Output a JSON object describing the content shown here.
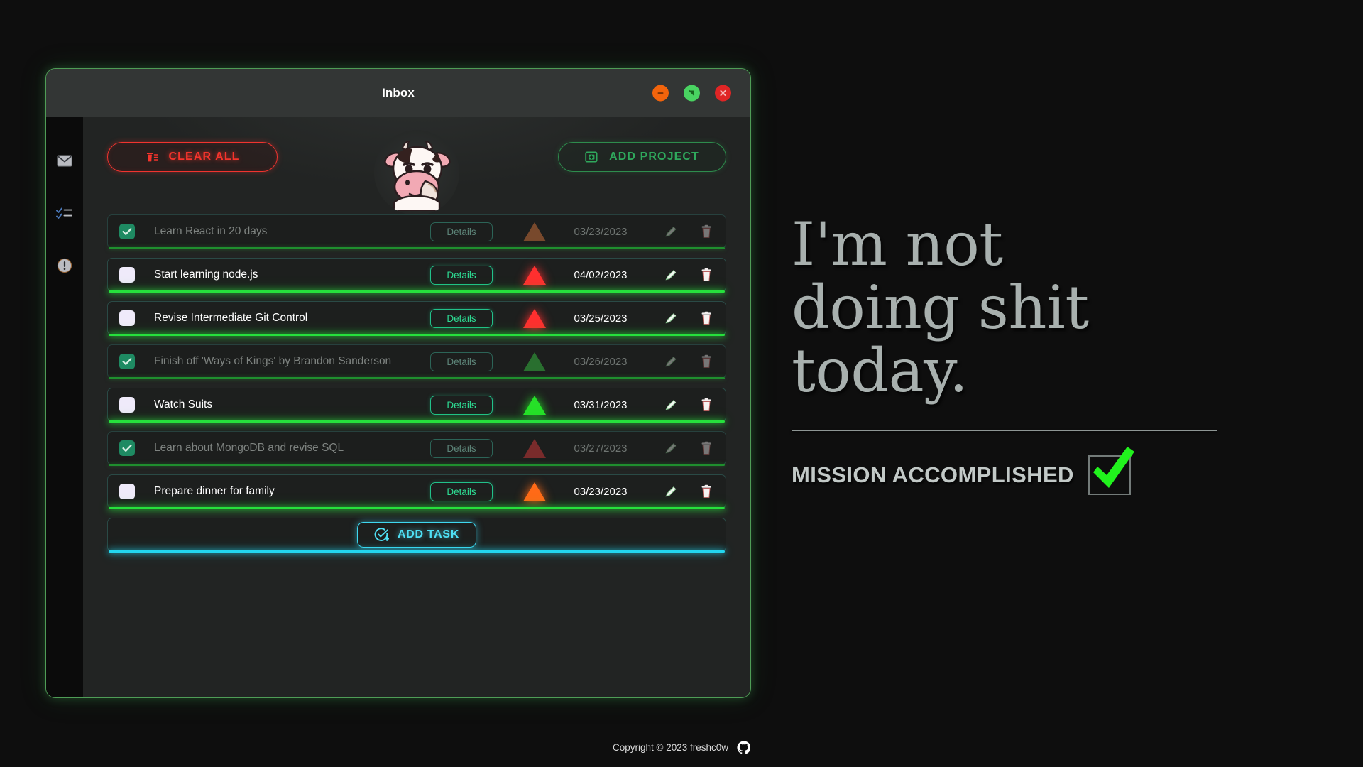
{
  "window": {
    "title": "Inbox",
    "controls": [
      {
        "name": "minimize",
        "icon": "minus-circle-icon",
        "color": "#f2640c"
      },
      {
        "name": "maximize",
        "icon": "maximize-circle-icon",
        "color": "#49d361"
      },
      {
        "name": "close",
        "icon": "close-circle-icon",
        "color": "#e02525"
      }
    ]
  },
  "sidebar": {
    "items": [
      {
        "name": "inbox",
        "icon": "envelope-icon"
      },
      {
        "name": "tasks",
        "icon": "checklist-icon"
      },
      {
        "name": "alerts",
        "icon": "exclamation-circle-icon"
      }
    ]
  },
  "toolbar": {
    "clear_all_label": "CLEAR ALL",
    "clear_all_icon": "trash-lines-icon",
    "add_project_label": "ADD PROJECT",
    "add_project_icon": "add-library-icon",
    "avatar_alt": "thinking-cow-avatar"
  },
  "task_list": {
    "details_label": "Details",
    "add_task_label": "ADD TASK",
    "add_task_icon": "check-circle-plus-icon",
    "edit_icon": "pencil-icon",
    "delete_icon": "trash-icon",
    "tasks": [
      {
        "title": "Learn React in 20 days",
        "details": "Details",
        "due": "03/23/2023",
        "priority": "medium",
        "priority_color": "#9c5a32",
        "done": true
      },
      {
        "title": "Start learning node.js",
        "details": "Details",
        "due": "04/02/2023",
        "priority": "high",
        "priority_color": "#ff2f2f",
        "done": false
      },
      {
        "title": "Revise Intermediate Git Control",
        "details": "Details",
        "due": "03/25/2023",
        "priority": "high",
        "priority_color": "#ff2f2f",
        "done": false
      },
      {
        "title": "Finish off 'Ways of Kings' by Brandon Sanderson",
        "details": "Details",
        "due": "03/26/2023",
        "priority": "low",
        "priority_color": "#2f8f36",
        "done": true
      },
      {
        "title": "Watch Suits",
        "details": "Details",
        "due": "03/31/2023",
        "priority": "low",
        "priority_color": "#26e028",
        "done": false
      },
      {
        "title": "Learn about MongoDB and revise SQL",
        "details": "Details",
        "due": "03/27/2023",
        "priority": "high",
        "priority_color": "#9e3030",
        "done": true
      },
      {
        "title": "Prepare dinner for family",
        "details": "Details",
        "due": "03/23/2023",
        "priority": "medium",
        "priority_color": "#ff6a17",
        "done": false
      }
    ]
  },
  "quote": {
    "text": "I'm not\ndoing shit\ntoday.",
    "mission_label": "MISSION ACCOMPLISHED",
    "mission_checked": true,
    "check_color": "#21f21d"
  },
  "footer": {
    "copyright": "Copyright © 2023 freshc0w",
    "github_icon": "github-icon"
  }
}
